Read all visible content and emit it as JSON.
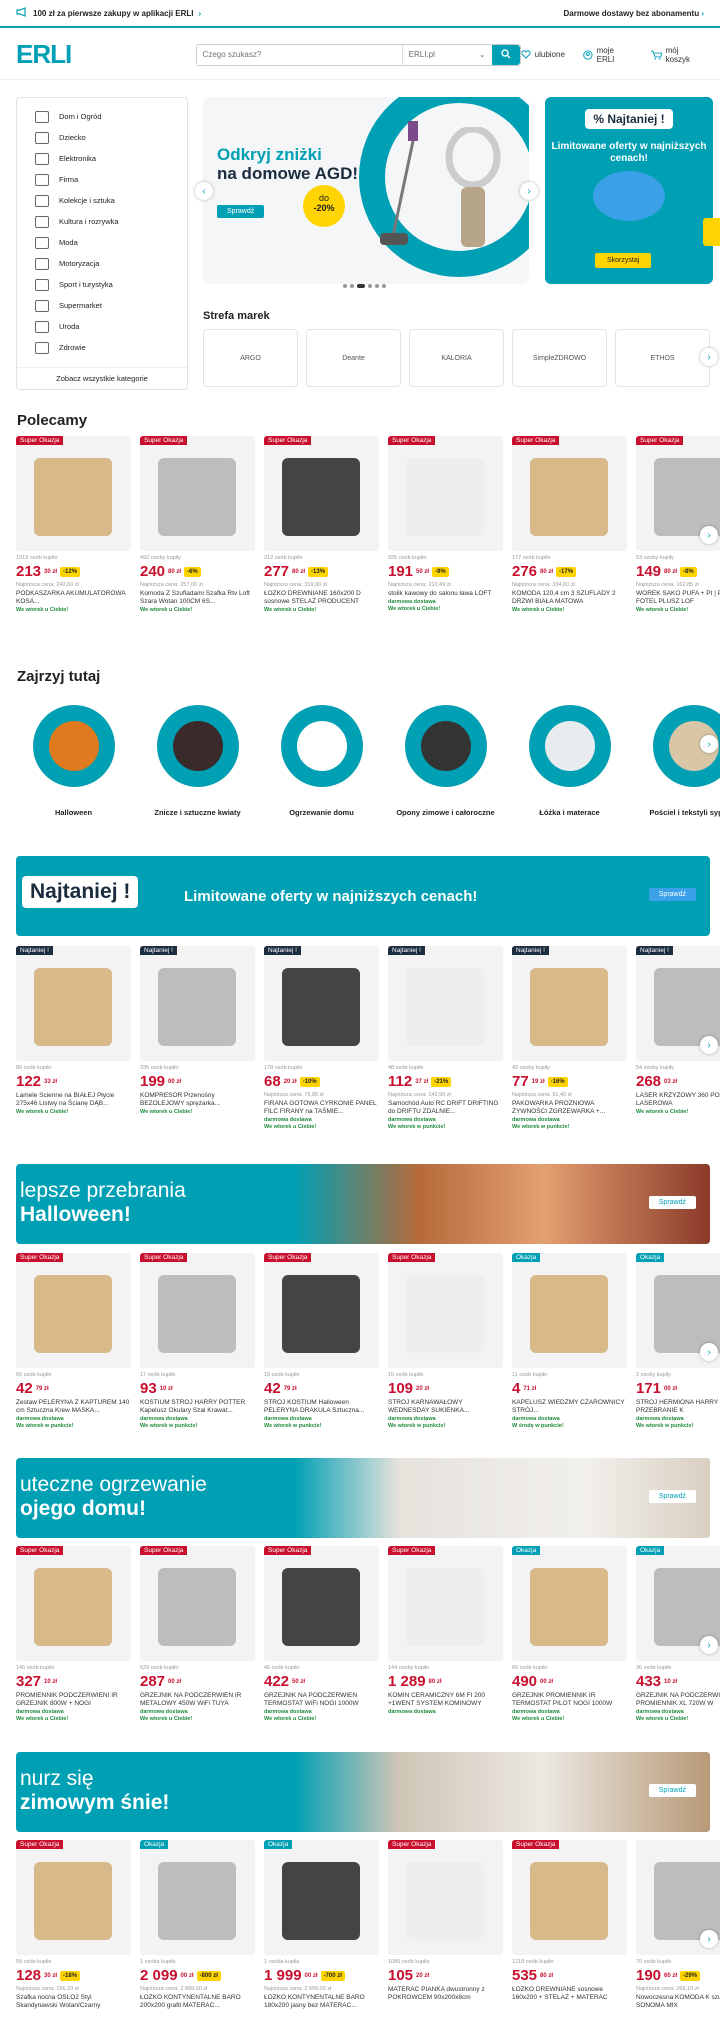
{
  "topbar": {
    "promo": "100 zł za pierwsze zakupy w aplikacji ERLI",
    "promo_arrow": "›",
    "shipping": "Darmowe dostawy bez abonamentu",
    "shipping_arrow": "›"
  },
  "header": {
    "logo": "ERLI",
    "search_placeholder": "Czego szukasz?",
    "search_scope": "ERLI.pl",
    "scope_chevron": "⌄",
    "links": [
      "ulubione",
      "moje ERLI",
      "mój koszyk"
    ]
  },
  "categories": {
    "items": [
      "Dom i Ogród",
      "Dziecko",
      "Elektronika",
      "Firma",
      "Kolekcje i sztuka",
      "Kultura i rozrywka",
      "Moda",
      "Motoryzacja",
      "Sport i turystyka",
      "Supermarket",
      "Uroda",
      "Zdrowie"
    ],
    "all": "Zobacz wszystkie kategorie"
  },
  "hero": {
    "line1": "Odkryj zniżki",
    "line2": "na domowe AGD!",
    "button": "Sprawdź",
    "badge_top": "do",
    "badge_val": "-20%",
    "prev": "‹",
    "next": "›"
  },
  "promo": {
    "badge": "% Najtaniej !",
    "text": "Limitowane oferty w najniższych cenach!",
    "button": "Skorzystaj"
  },
  "strefa": {
    "title": "Strefa marek",
    "brands": [
      "ARGO",
      "Deante",
      "KALORIA",
      "SimpleZDROWO",
      "ETHOS"
    ],
    "next": "›"
  },
  "polecamy": {
    "title": "Polecamy",
    "next": "›",
    "products": [
      {
        "tag": "Super Okazja",
        "sold": "1919 osób kupiło",
        "price": "213",
        "gr": "30 zł",
        "discount": "-12%",
        "low": "Najniższa cena: 242,60 zł",
        "name": "PODKASZARKA AKUMULATOROWA KOSA...",
        "ship": "We wtorek u Ciebie!"
      },
      {
        "tag": "Super Okazja",
        "sold": "492 osoby kupiły",
        "price": "240",
        "gr": "80 zł",
        "discount": "-6%",
        "low": "Najniższa cena: 257,00 zł",
        "name": "Komoda Z Szufladami Szafka Rtv Loft Szara Wotan 100CM 6S...",
        "ship": "We wtorek u Ciebie!"
      },
      {
        "tag": "Super Okazja",
        "sold": "212 osób kupiło",
        "price": "277",
        "gr": "80 zł",
        "discount": "-13%",
        "low": "Najniższa cena: 319,90 zł",
        "name": "ŁÓŻKO DREWNIANE 160x200 D sosnowe STELAŻ PRODUCENT",
        "ship": "We wtorek u Ciebie!"
      },
      {
        "tag": "Super Okazja",
        "sold": "925 osób kupiło",
        "price": "191",
        "gr": "50 zł",
        "discount": "-9%",
        "low": "Najniższa cena: 210,49 zł",
        "name": "stolik kawowy do salonu ława LOFT",
        "ship": "darmowa dostawa",
        "ship2": "We wtorek u Ciebie!"
      },
      {
        "tag": "Super Okazja",
        "sold": "177 osób kupiło",
        "price": "276",
        "gr": "80 zł",
        "discount": "-17%",
        "low": "Najniższa cena: 334,00 zł",
        "name": "KOMODA 120,4 cm 3 SZUFLADY 2 DRZWI BIAŁA MATOWA",
        "ship": "We wtorek u Ciebie!"
      },
      {
        "tag": "Super Okazja",
        "sold": "53 osoby kupiły",
        "price": "149",
        "gr": "80 zł",
        "discount": "-8%",
        "low": "Najniższa cena: 162,85 zł",
        "name": "WOREK SAKO PUFA + PI | PUF FOTEL PLUSZ LOF",
        "ship": "We wtorek u Ciebie!"
      }
    ]
  },
  "zajrzyj": {
    "title": "Zajrzyj tutaj",
    "next": "›",
    "items": [
      "Halloween",
      "Znicze i sztuczne kwiaty",
      "Ogrzewanie domu",
      "Opony zimowe i całoroczne",
      "Łóżka i materace",
      "Pościel i tekstyli sypialni"
    ]
  },
  "banner1": {
    "badge": "Najtaniej !",
    "text": "Limitowane oferty w najniższych cenach!",
    "button": "Sprawdź"
  },
  "najtaniej": {
    "next": "›",
    "products": [
      {
        "tag": "Najtaniej !",
        "sold": "80 osób kupiło",
        "price": "122",
        "gr": "33 zł",
        "discount": "",
        "low": "",
        "name": "Lamele Ścienne na BIAŁEJ Płycie 275x46 Listwy na Ścianę DĄB...",
        "ship": "We wtorek u Ciebie!"
      },
      {
        "tag": "Najtaniej !",
        "sold": "335 osób kupiło",
        "price": "199",
        "gr": "00 zł",
        "discount": "",
        "low": "",
        "name": "KOMPRESOR Przenośny BEZOLEJOWY sprężarka...",
        "ship": "We wtorek u Ciebie!"
      },
      {
        "tag": "Najtaniej !",
        "sold": "178 osób kupiło",
        "price": "68",
        "gr": "20 zł",
        "discount": "-10%",
        "low": "Najniższa cena: 75,85 zł",
        "name": "FIRANA GOTOWA CYRKONIE PANEL FILC FIRANY na TAŚMIE...",
        "ship": "darmowa dostawa",
        "ship2": "We wtorek u Ciebie!"
      },
      {
        "tag": "Najtaniej !",
        "sold": "48 osób kupiło",
        "price": "112",
        "gr": "37 zł",
        "discount": "-21%",
        "low": "Najniższa cena: 142,90 zł",
        "name": "Samochód Auto RC DRIFT DRIFTING do DRIFTU ZDALNIE...",
        "ship": "darmowa dostawa",
        "ship2": "We wtorek w punkcie!"
      },
      {
        "tag": "Najtaniej !",
        "sold": "43 osoby kupiły",
        "price": "77",
        "gr": "19 zł",
        "discount": "-16%",
        "low": "Najniższa cena: 91,40 zł",
        "name": "PAKOWARKA PRÓŻNIOWA ŻYWNOŚCI ZGRZEWARKA +...",
        "ship": "darmowa dostawa",
        "ship2": "We wtorek w punkcie!"
      },
      {
        "tag": "Najtaniej !",
        "sold": "54 osoby kupiły",
        "price": "268",
        "gr": "03 zł",
        "discount": "",
        "low": "",
        "name": "LASER KRZYŻOWY 360 POZIOMICA LASEROWA",
        "ship": "We wtorek u Ciebie!"
      }
    ]
  },
  "banner2": {
    "line1": "lepsze przebrania",
    "line2": "Halloween!",
    "button": "Sprawdź"
  },
  "halloween": {
    "next": "›",
    "products": [
      {
        "tag": "Super Okazja",
        "sold": "65 osób kupiło",
        "price": "42",
        "gr": "79 zł",
        "discount": "",
        "low": "",
        "name": "Zestaw PELERYNA Z KAPTUREM 140 cm Sztuczna Krew MASKA...",
        "ship": "darmowa dostawa",
        "ship2": "We wtorek w punkcie!"
      },
      {
        "tag": "Super Okazja",
        "sold": "17 osób kupiło",
        "price": "93",
        "gr": "10 zł",
        "discount": "",
        "low": "",
        "name": "KOSTIUM STRÓJ HARRY POTTER Kapelusz Okulary Szal Krawat...",
        "ship": "darmowa dostawa",
        "ship2": "We wtorek w punkcie!"
      },
      {
        "tag": "Super Okazja",
        "sold": "15 osób kupiło",
        "price": "42",
        "gr": "79 zł",
        "discount": "",
        "low": "",
        "name": "STRÓJ KOSTIUM Halloween PELERYNA DRAKULA Sztuczna...",
        "ship": "darmowa dostawa",
        "ship2": "We wtorek w punkcie!"
      },
      {
        "tag": "Super Okazja",
        "sold": "10 osób kupiło",
        "price": "109",
        "gr": "20 zł",
        "discount": "",
        "low": "",
        "name": "STRÓJ KARNAWAŁOWY WEDNESDAY SUKIENKA...",
        "ship": "darmowa dostawa",
        "ship2": "We wtorek w punkcie!"
      },
      {
        "tag": "Okazja",
        "sold": "11 osób kupiło",
        "price": "4",
        "gr": "71 zł",
        "discount": "",
        "low": "",
        "name": "KAPELUSZ WIEDŹMY CZAROWNICY STRÓJ...",
        "ship": "darmowa dostawa",
        "ship2": "W środę w punkcie!"
      },
      {
        "tag": "Okazja",
        "sold": "2 osoby kupiły",
        "price": "171",
        "gr": "00 zł",
        "discount": "",
        "low": "",
        "name": "STRÓJ HERMIONA HARRY POTTER PRZEBRANIE K",
        "ship": "darmowa dostawa",
        "ship2": "We wtorek w punkcie!"
      }
    ]
  },
  "banner3": {
    "line1": "uteczne ogrzewanie",
    "line2": "ojego domu!",
    "button": "Sprawdź"
  },
  "heating": {
    "next": "›",
    "products": [
      {
        "tag": "Super Okazja",
        "sold": "146 osób kupiło",
        "price": "327",
        "gr": "10 zł",
        "discount": "",
        "low": "",
        "name": "PROMIENNIK PODCZERWIENI IR GRZEJNIK 800W + NOGI",
        "ship": "darmowa dostawa",
        "ship2": "We wtorek u Ciebie!"
      },
      {
        "tag": "Super Okazja",
        "sold": "529 osób kupiło",
        "price": "287",
        "gr": "00 zł",
        "discount": "",
        "low": "",
        "name": "GRZEJNIK NA PODCZERWIEŃ IR METALOWY 450W WiFi TUYA",
        "ship": "darmowa dostawa",
        "ship2": "We wtorek u Ciebie!"
      },
      {
        "tag": "Super Okazja",
        "sold": "46 osób kupiło",
        "price": "422",
        "gr": "50 zł",
        "discount": "",
        "low": "",
        "name": "GRZEJNIK NA PODCZERWIEŃ TERMOSTAT WiFi NOGI 1000W",
        "ship": "darmowa dostawa",
        "ship2": "We wtorek u Ciebie!"
      },
      {
        "tag": "Super Okazja",
        "sold": "144 osoby kupiło",
        "price": "1 289",
        "gr": "80 zł",
        "discount": "",
        "low": "",
        "name": "KOMIN CERAMICZNY 6M FI 200 +1WENT SYSTEM KOMINOWY",
        "ship": "darmowa dostawa"
      },
      {
        "tag": "Okazja",
        "sold": "65 osób kupiło",
        "price": "490",
        "gr": "00 zł",
        "discount": "",
        "low": "",
        "name": "GRZEJNIK PROMIENNIK IR TERMOSTAT PILOT NOGI 1000W",
        "ship": "darmowa dostawa",
        "ship2": "We wtorek u Ciebie!"
      },
      {
        "tag": "Okazja",
        "sold": "36 osób kupiło",
        "price": "433",
        "gr": "10 zł",
        "discount": "",
        "low": "",
        "name": "GRZEJNIK NA PODCZERWIEŃ PROMIENNIK XL 720W W",
        "ship": "darmowa dostawa",
        "ship2": "We wtorek u Ciebie!"
      }
    ]
  },
  "banner4": {
    "line1": "nurz się",
    "line2": "zimowym śnie!",
    "button": "Sprawdź"
  },
  "sleep": {
    "next": "›",
    "products": [
      {
        "tag": "Super Okazja",
        "sold": "58 osób kupiło",
        "price": "128",
        "gr": "30 zł",
        "discount": "-18%",
        "low": "Najniższa cena: 156,33 zł",
        "name": "Szafka nocna OSLO2 Styl Skandynawski Wotan/Czarny",
        "ship": ""
      },
      {
        "tag": "Okazja",
        "sold": "1 osoba kupiła",
        "price": "2 099",
        "gr": "00 zł",
        "discount": "-800 zł",
        "low": "Najniższa cena: 2 899,00 zł",
        "name": "ŁÓŻKO KONTYNENTALNE BARO 200x200 grafit MATERAC...",
        "ship": ""
      },
      {
        "tag": "Okazja",
        "sold": "1 osoba kupiła",
        "price": "1 999",
        "gr": "00 zł",
        "discount": "-700 zł",
        "low": "Najniższa cena: 2 699,00 zł",
        "name": "ŁÓŻKO KONTYNENTALNE BARO 180x200 jasny bez MATERAC...",
        "ship": ""
      },
      {
        "tag": "Super Okazja",
        "sold": "1085 osób kupiło",
        "price": "105",
        "gr": "20 zł",
        "discount": "",
        "low": "",
        "name": "MATERAC PIANKA dwustronny z POKROWCEM 90x200x8cm",
        "ship": ""
      },
      {
        "tag": "Super Okazja",
        "sold": "1218 osób kupiło",
        "price": "535",
        "gr": "80 zł",
        "discount": "",
        "low": "",
        "name": "ŁÓŻKO DREWNIANE sosnowe 160x200 + STELAŻ + MATERAC",
        "ship": ""
      },
      {
        "tag": "",
        "sold": "76 osób kupiło",
        "price": "190",
        "gr": "60 zł",
        "discount": "-29%",
        "low": "Najniższa cena: 268,10 zł",
        "name": "Nowoczesna KOMODA K szuflady - SONOMA MIX",
        "ship": ""
      }
    ]
  },
  "colors": {
    "accent": "#00a0b4",
    "price": "#c8102e",
    "badge": "#ffd400",
    "ship": "#1e8a3c",
    "dark": "#1b2c3f"
  }
}
